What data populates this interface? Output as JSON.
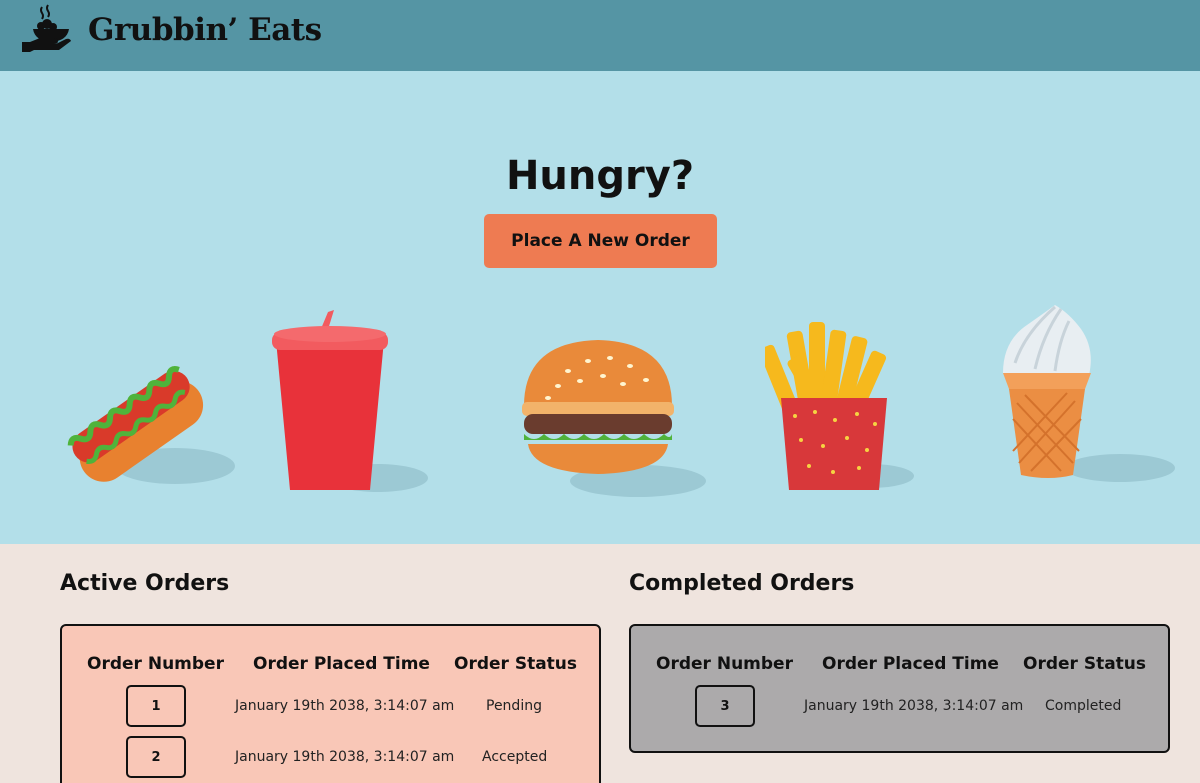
{
  "brand": {
    "name": "Grubbin’ Eats",
    "logo_icon": "hand-serving-bowl-icon"
  },
  "hero": {
    "title": "Hungry?",
    "cta_label": "Place A New Order",
    "foods": [
      "hot-dog",
      "soda-cup",
      "burger",
      "fries",
      "ice-cream-cone"
    ]
  },
  "active_orders": {
    "title": "Active Orders",
    "columns": [
      "Order Number",
      "Order Placed Time",
      "Order Status"
    ],
    "rows": [
      {
        "number": "1",
        "time": "January 19th 2038, 3:14:07 am",
        "status": "Pending"
      },
      {
        "number": "2",
        "time": "January 19th 2038, 3:14:07 am",
        "status": "Accepted"
      }
    ]
  },
  "completed_orders": {
    "title": "Completed Orders",
    "columns": [
      "Order Number",
      "Order Placed Time",
      "Order Status"
    ],
    "rows": [
      {
        "number": "3",
        "time": "January 19th 2038, 3:14:07 am",
        "status": "Completed"
      }
    ]
  },
  "colors": {
    "header": "#5595a4",
    "hero": "#b3dfe9",
    "cta": "#ee7b52",
    "active_panel": "#f9c7b7",
    "completed_panel": "#acaaab",
    "page": "#efe4de"
  }
}
